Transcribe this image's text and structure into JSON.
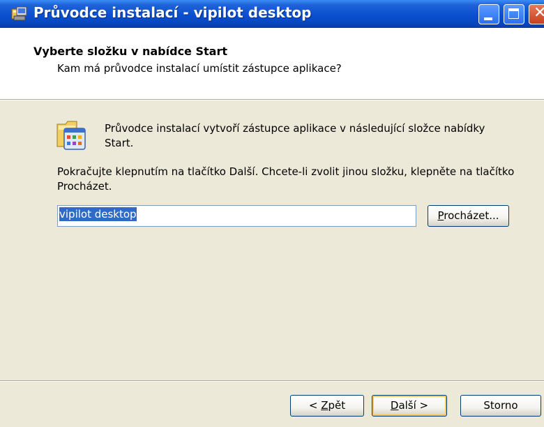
{
  "window": {
    "title": "Průvodce instalací - vipilot desktop"
  },
  "header": {
    "title": "Vyberte složku v nabídce Start",
    "subtitle": "Kam má průvodce instalací umístit zástupce aplikace?"
  },
  "body": {
    "intro": "Průvodce instalací vytvoří zástupce aplikace v následující složce nabídky Start.",
    "instruction": "Pokračujte klepnutím na tlačítko Další. Chcete-li zvolit jinou složku, klepněte na tlačítko Procházet.",
    "folder_value": "vipilot desktop"
  },
  "buttons": {
    "browse_access": "P",
    "browse_rest": "rocházet...",
    "back_prefix": "< ",
    "back_access": "Z",
    "back_rest": "pět",
    "next_access": "D",
    "next_rest": "alší >",
    "cancel": "Storno"
  },
  "icons": {
    "title": "installer-icon",
    "folder": "start-menu-folder-icon"
  },
  "colors": {
    "titlebar": "#0a4fcf",
    "dialog_bg": "#ECE9D8",
    "selection": "#316ac5"
  }
}
